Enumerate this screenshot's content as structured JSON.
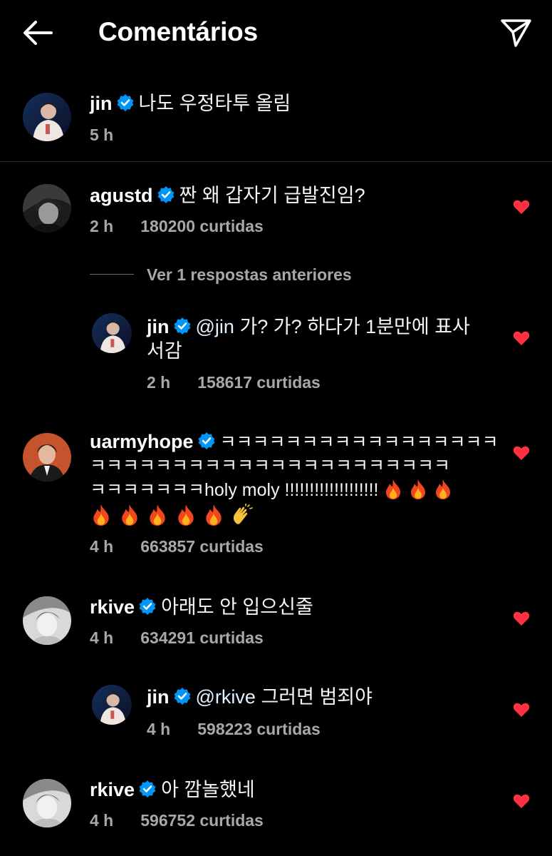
{
  "header": {
    "title": "Comentários",
    "back_icon": "arrow-left-icon",
    "send_icon": "paper-plane-icon"
  },
  "caption": {
    "username": "jin",
    "text": "나도 우정타투 올림",
    "time": "5 h"
  },
  "comments": [
    {
      "username": "agustd",
      "text": "짠 왜 갑자기 급발진임?",
      "time": "2 h",
      "likes": "180200 curtidas",
      "liked": true
    },
    {
      "username": "jin",
      "mention": "@jin",
      "text": "가? 가? 하다가 1분만에 표사",
      "text_line2": "서감",
      "time": "2 h",
      "likes": "158617 curtidas",
      "liked": true,
      "is_reply": true
    },
    {
      "username": "uarmyhope",
      "text_line1": "ㅋㅋㅋㅋㅋㅋㅋㅋㅋㅋㅋㅋㅋㅋㅋㅋㅋ",
      "text_line2": "ㅋㅋㅋㅋㅋㅋㅋㅋㅋㅋㅋㅋㅋㅋㅋㅋㅋㅋㅋㅋㅋㅋ",
      "text_line3": "ㅋㅋㅋㅋㅋㅋㅋholy moly !!!!!!!!!!!!!!!!!!!",
      "time": "4 h",
      "likes": "663857 curtidas",
      "liked": true
    },
    {
      "username": "rkive",
      "text": "아래도 안 입으신줄",
      "time": "4 h",
      "likes": "634291 curtidas",
      "liked": true
    },
    {
      "username": "jin",
      "mention": "@rkive",
      "text": "그러면 범죄야",
      "time": "4 h",
      "likes": "598223 curtidas",
      "liked": true,
      "is_reply": true
    },
    {
      "username": "rkive",
      "text": "아 깜놀했네",
      "time": "4 h",
      "likes": "596752 curtidas",
      "liked": true
    }
  ],
  "view_previous_replies": "Ver 1 respostas anteriores",
  "colors": {
    "background": "#000000",
    "verified": "#0095f6",
    "heart": "#ff3040",
    "meta": "#a8a8a8"
  }
}
